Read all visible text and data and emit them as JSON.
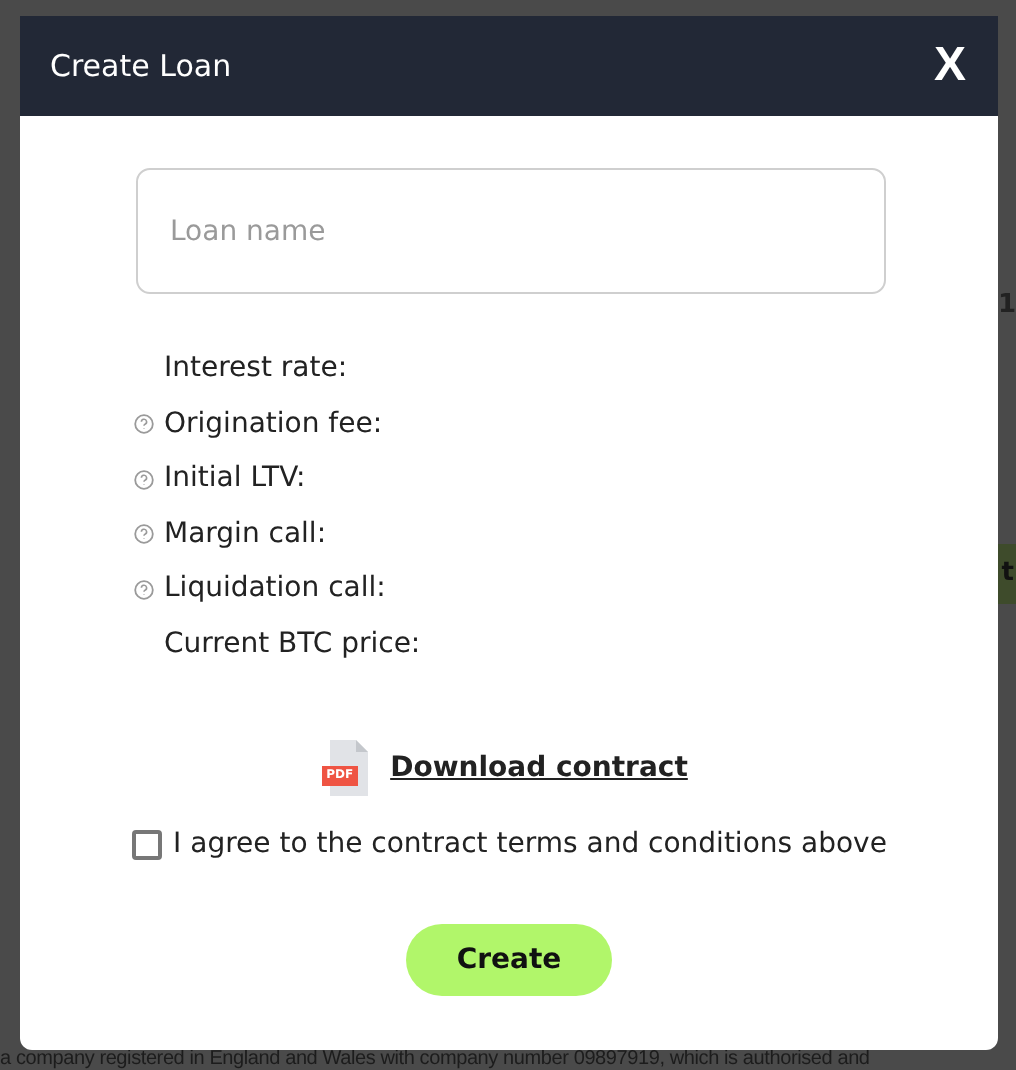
{
  "background": {
    "side_texts": [
      {
        "kind": "plain",
        "text": "1"
      },
      {
        "kind": "button",
        "text": "t"
      }
    ],
    "footer": "a company registered in England and Wales with company number 09897919, which is authorised and"
  },
  "dialog": {
    "title": "Create Loan",
    "close": "X",
    "name_field": {
      "placeholder": "Loan name"
    },
    "details": [
      {
        "label": "Interest rate:",
        "help": false
      },
      {
        "label": "Origination fee:",
        "help": true
      },
      {
        "label": "Initial LTV:",
        "help": true
      },
      {
        "label": "Margin call:",
        "help": true
      },
      {
        "label": "Liquidation call:",
        "help": true
      },
      {
        "label": "Current BTC price:",
        "help": false
      }
    ],
    "download": {
      "badge": "PDF",
      "label": "Download contract"
    },
    "agree": {
      "label": "I agree to the contract terms and conditions above",
      "checked": false
    },
    "submit": "Create"
  }
}
